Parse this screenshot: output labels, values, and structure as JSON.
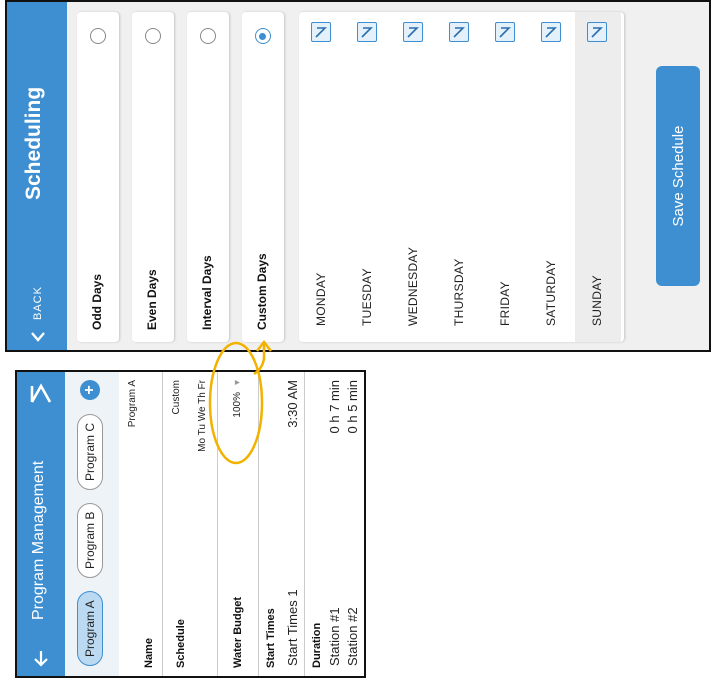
{
  "scheduling": {
    "back_label": "BACK",
    "title": "Scheduling",
    "options": [
      {
        "label": "Odd Days",
        "selected": false
      },
      {
        "label": "Even Days",
        "selected": false
      },
      {
        "label": "Interval Days",
        "selected": false
      },
      {
        "label": "Custom Days",
        "selected": true
      }
    ],
    "days": [
      {
        "label": "MONDAY",
        "checked": true
      },
      {
        "label": "TUESDAY",
        "checked": true
      },
      {
        "label": "WEDNESDAY",
        "checked": true
      },
      {
        "label": "THURSDAY",
        "checked": true
      },
      {
        "label": "FRIDAY",
        "checked": true
      },
      {
        "label": "SATURDAY",
        "checked": true
      },
      {
        "label": "SUNDAY",
        "checked": true
      }
    ],
    "save_label": "Save Schedule"
  },
  "program_management": {
    "title": "Program Management",
    "tabs": [
      {
        "label": "Program A",
        "active": true
      },
      {
        "label": "Program B",
        "active": false
      },
      {
        "label": "Program C",
        "active": false
      }
    ],
    "rows": {
      "name": {
        "label": "Name",
        "value": "Program A"
      },
      "schedule": {
        "label": "Schedule",
        "type": "Custom",
        "days": "Mo Tu We Th Fr"
      },
      "water_budget": {
        "label": "Water Budget",
        "value": "100%"
      },
      "start_times": {
        "label": "Start Times",
        "item_label": "Start Times 1",
        "item_value": "3:30 AM"
      },
      "duration": {
        "label": "Duration",
        "stations": [
          {
            "label": "Station #1",
            "value": "0 h 7 min"
          },
          {
            "label": "Station #2",
            "value": "0 h 5 min"
          }
        ]
      }
    }
  },
  "colors": {
    "accent": "#3d8fd1",
    "highlight": "#f2b200"
  }
}
